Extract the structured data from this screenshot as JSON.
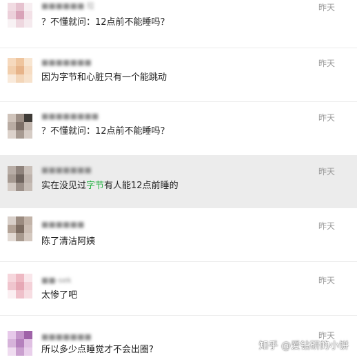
{
  "comments": [
    {
      "username": "■■■■■■ 垃",
      "time": "昨天",
      "text": "？不懂就问：12点前不能睡吗？",
      "avatar_colors": [
        "#f1dbe2",
        "#e6c2cf",
        "#f7eef1",
        "#ecd0da",
        "#d9a3b8",
        "#f3e1e7",
        "#f8f2f4",
        "#eed7df",
        "#f5eaee"
      ]
    },
    {
      "username": "■■■■■■■",
      "time": "昨天",
      "text": "因为字节和心脏只有一个能跳动",
      "avatar_colors": [
        "#f6d9bd",
        "#efc59e",
        "#f8e6d2",
        "#f2cfad",
        "#e7b48a",
        "#f6dcc2",
        "#f9eadb",
        "#f3d6b9",
        "#f7e2cc"
      ]
    },
    {
      "username": "■■■■■■■■",
      "time": "昨天",
      "text": "？不懂就问：12点前不能睡吗？",
      "avatar_colors": [
        "#cfc3ba",
        "#9d8f86",
        "#3f3b37",
        "#b9aca3",
        "#7e7068",
        "#c4b8b0",
        "#dcd2cb",
        "#a79a91",
        "#d6ccc5"
      ]
    },
    {
      "username": "■■■■■■■",
      "time": "昨天",
      "text_before": "实在没见过",
      "text_keyword": "字节",
      "text_after": "有人能12点前睡的",
      "avatar_colors": [
        "#b8ada6",
        "#8f837c",
        "#c9bfb8",
        "#a59991",
        "#6f645e",
        "#bdb2ab",
        "#d2c9c3",
        "#9c9089",
        "#c6bcb5"
      ]
    },
    {
      "username": "■■■■■■",
      "time": "昨天",
      "text": "陈了清洁阿姨",
      "avatar_colors": [
        "#d8cfc9",
        "#9b8b80",
        "#c2b3a8",
        "#b3a397",
        "#7d6d62",
        "#cbbdb3",
        "#e2dad4",
        "#a89a8f",
        "#d4c8bf"
      ]
    },
    {
      "username": "■■-sek",
      "time": "昨天",
      "text": "太惨了吧",
      "avatar_colors": [
        "#f6d6dc",
        "#eeb9c3",
        "#f9e6ea",
        "#f0c5ce",
        "#e6a8b5",
        "#f4d1d8",
        "#fbeff2",
        "#efc0ca",
        "#f7dde2"
      ]
    },
    {
      "username": "■■■■■■■",
      "time": "昨天",
      "text": "所以多少点睡觉才不会出圈?",
      "avatar_colors": [
        "#e7c9ea",
        "#c596cb",
        "#9f63a8",
        "#d6b3da",
        "#b581bd",
        "#e0c0e3",
        "#efdcf0",
        "#caa0cf",
        "#e9cfeb"
      ]
    }
  ],
  "watermark": "知乎 @爱钻研的小饼",
  "colors": {
    "keyword": "#2db34a",
    "highlight_row": "#ececec",
    "time": "#9a9a9a"
  }
}
